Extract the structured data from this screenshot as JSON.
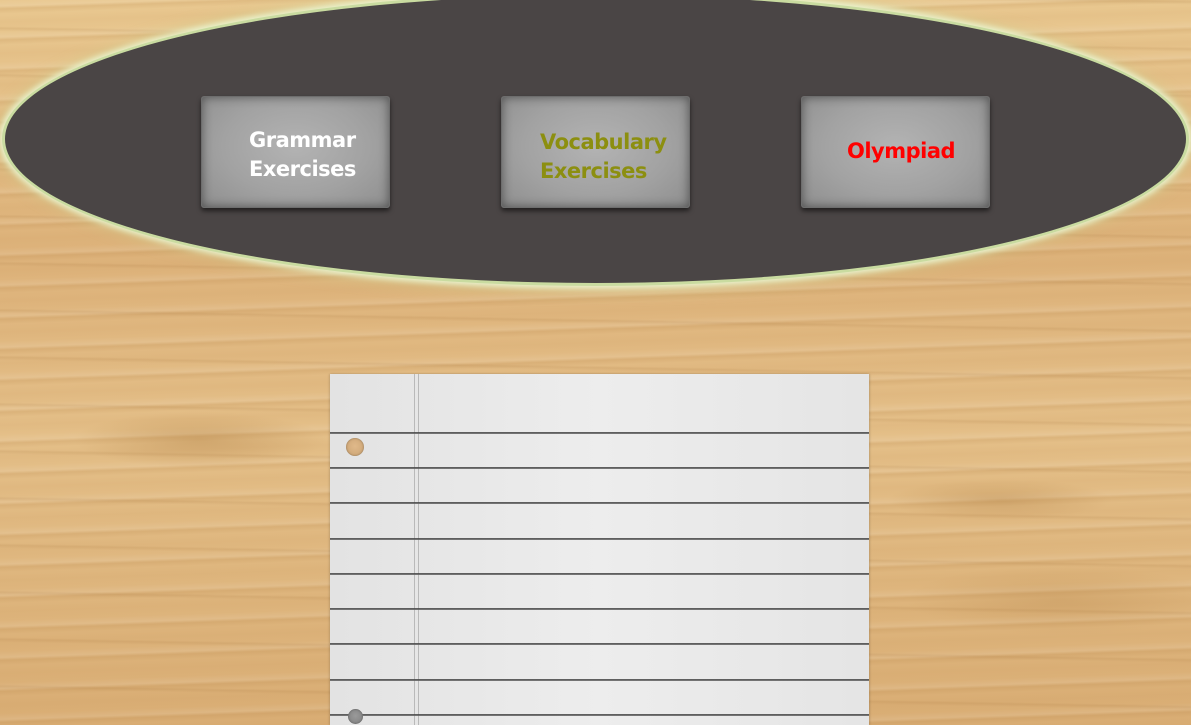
{
  "menu": {
    "buttons": [
      {
        "label": "Grammar\nExercises",
        "color": "#ffffff"
      },
      {
        "label": "Vocabulary\nExercises",
        "color": "#8c8f10"
      },
      {
        "label": "Olympiad",
        "color": "#ff0000"
      }
    ]
  },
  "colors": {
    "menu_background": "#4a4545",
    "menu_border": "#c9dba0",
    "button_face": "#a2a2a2",
    "paper": "#ececec"
  }
}
